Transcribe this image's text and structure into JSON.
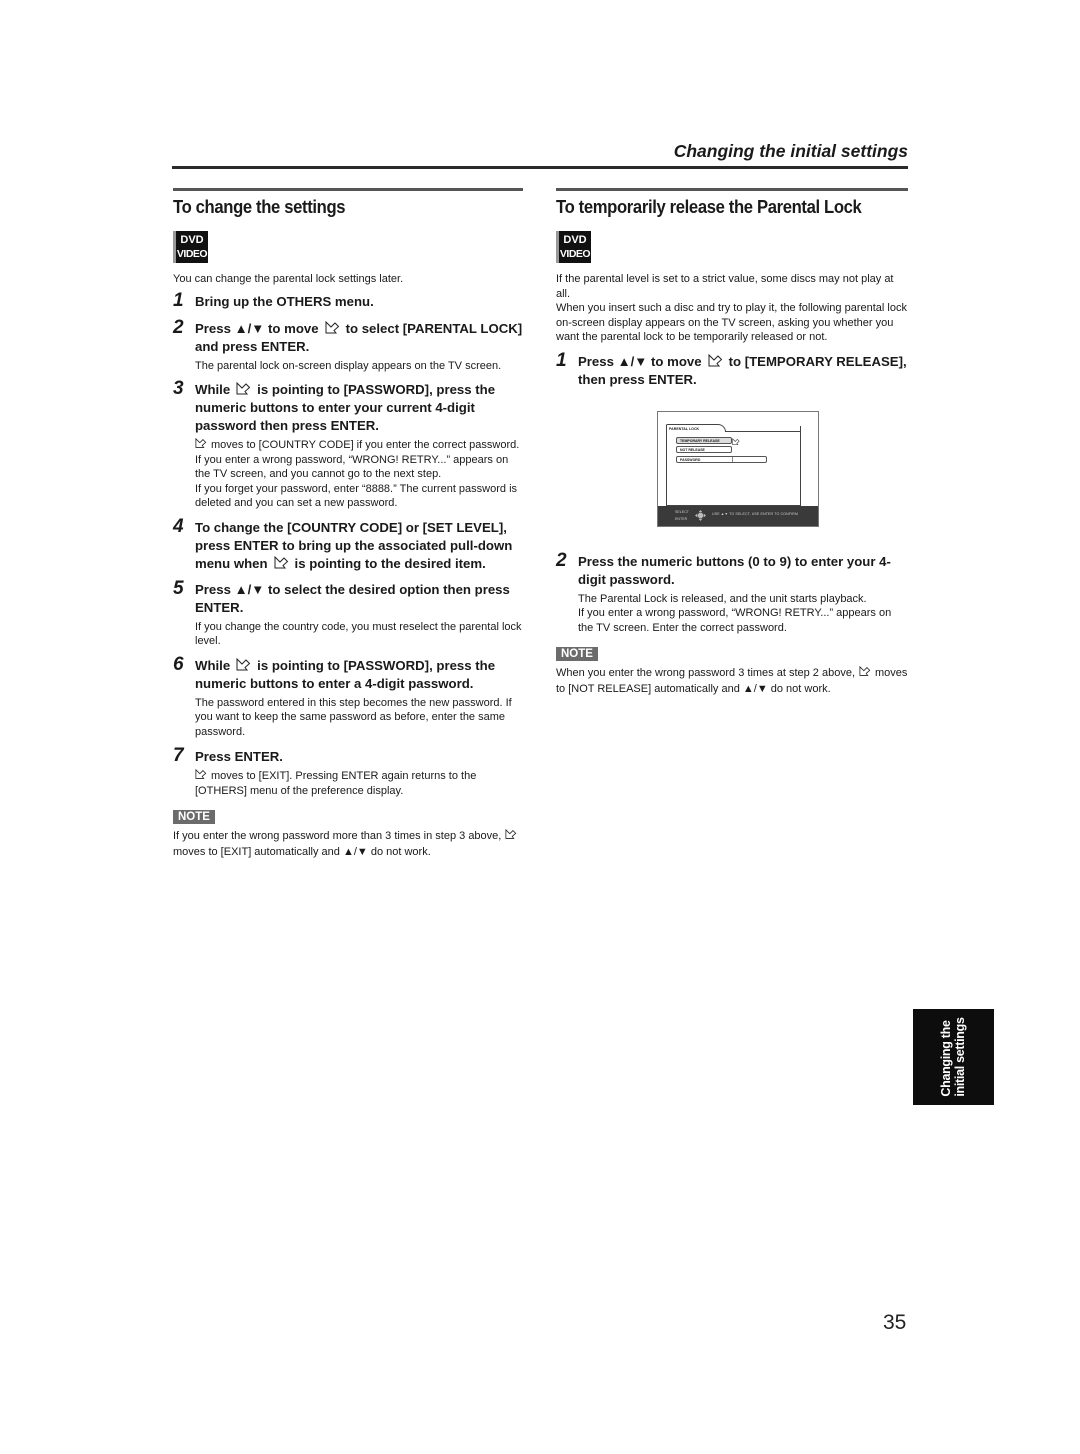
{
  "header": {
    "title": "Changing the initial settings"
  },
  "left": {
    "title": "To change the settings",
    "badge": {
      "line1": "DVD",
      "line2": "VIDEO"
    },
    "intro": "You can change the parental lock settings later.",
    "steps": [
      {
        "num": "1",
        "head": "Bring up the OTHERS menu."
      },
      {
        "num": "2",
        "head_pre": "Press ▲/▼ to move",
        "head_post": "to select [PARENTAL LOCK] and press ENTER.",
        "body": "The parental lock on-screen display appears on the TV screen."
      },
      {
        "num": "3",
        "head_pre": "While",
        "head_post": "is pointing to [PASSWORD], press the numeric buttons to enter your current 4-digit password then press ENTER.",
        "body1": "moves to [COUNTRY CODE] if you enter the correct password.",
        "body2": "If you enter a wrong password, “WRONG! RETRY...” appears on the TV screen, and you cannot go to the next step.",
        "body3": "If you forget your password, enter “8888.” The current password is deleted and you can set a new password."
      },
      {
        "num": "4",
        "head_pre": "To change the [COUNTRY CODE] or [SET LEVEL], press ENTER to bring up the associated pull-down menu when",
        "head_post": "is pointing to the desired item."
      },
      {
        "num": "5",
        "head": "Press ▲/▼ to select the desired option then press ENTER.",
        "body": "If you change the country code, you must reselect the parental lock level."
      },
      {
        "num": "6",
        "head_pre": "While",
        "head_post": "is pointing to [PASSWORD], press the numeric buttons to enter a 4-digit password.",
        "body": "The password entered in this step becomes the new password. If you want to keep the same password as before, enter the same password."
      },
      {
        "num": "7",
        "head": "Press ENTER.",
        "body": "moves to [EXIT]. Pressing ENTER again returns to the [OTHERS] menu of the preference display."
      }
    ],
    "note": {
      "label": "NOTE",
      "text_pre": "If you enter the wrong password more than 3 times in step 3 above,",
      "text_post": "moves to [EXIT] automatically and ▲/▼ do not work."
    }
  },
  "right": {
    "title": "To temporarily release the Parental Lock",
    "badge": {
      "line1": "DVD",
      "line2": "VIDEO"
    },
    "intro1": "If the parental level is set to a strict value, some discs may not play at all.",
    "intro2": "When you insert such a disc and try to play it, the following parental lock on-screen display appears on the TV screen, asking you whether you want the parental lock to be temporarily released or not.",
    "steps": [
      {
        "num": "1",
        "head_pre": "Press ▲/▼ to move",
        "head_post": "to [TEMPORARY RELEASE], then press ENTER."
      },
      {
        "num": "2",
        "head": "Press the numeric buttons (0 to 9) to enter your 4-digit password.",
        "body1": "The Parental Lock is released, and the unit starts playback.",
        "body2": "If you enter a wrong password, “WRONG! RETRY...” appears on the TV screen. Enter the correct password."
      }
    ],
    "osd": {
      "tab": "PARENTAL LOCK",
      "items": [
        "TEMPORARY RELEASE",
        "NOT RELEASE"
      ],
      "password_label": "PASSWORD",
      "password_value": "- - - -",
      "footer_select": "SELECT",
      "footer_enter": "ENTER",
      "footer_msg": "USE ▲▼ TO SELECT, USE ENTER TO CONFIRM"
    },
    "note": {
      "label": "NOTE",
      "text_pre": "When you enter the wrong password 3 times at step 2 above,",
      "text_post": "moves to [NOT RELEASE] automatically and ▲/▼ do not work."
    }
  },
  "side_tab": {
    "line1": "Changing the",
    "line2": "initial settings"
  },
  "page_number": "35"
}
